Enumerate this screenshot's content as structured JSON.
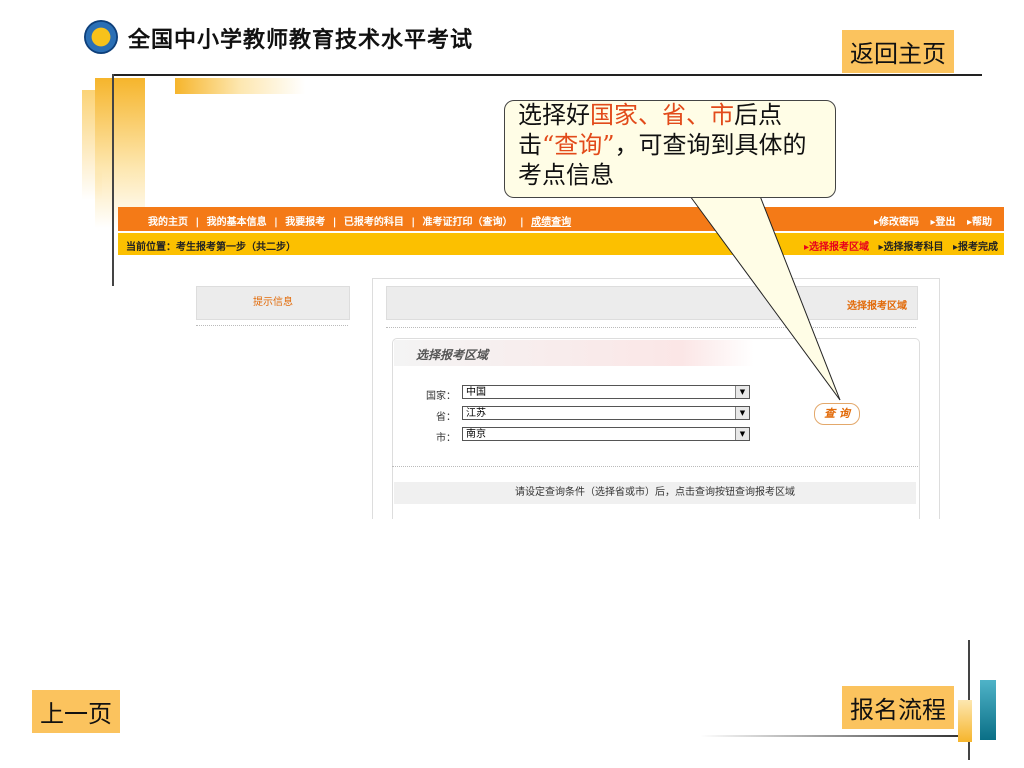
{
  "slide": {
    "title": "全国中小学教师教育技术水平考试",
    "home_button": "返回主页",
    "prev_button": "上一页",
    "flow_button": "报名流程"
  },
  "callout": {
    "part1": "选择好",
    "part2": "国家、省、市",
    "part3": "后点击",
    "part4": "“查询”",
    "part5": "，可查询到具体的考点信息"
  },
  "nav": {
    "links": [
      "我的主页",
      "|",
      "我的基本信息",
      "|",
      "我要报考",
      "|",
      "已报考的科目",
      "|",
      "准考证打印（查询）",
      "|",
      "成绩查询"
    ],
    "right": [
      "▸修改密码",
      "▸登出",
      "▸帮助"
    ]
  },
  "location": {
    "label": "当前位置：考生报考第一步（共二步）",
    "steps": [
      "▸选择报考区域",
      "▸选择报考科目",
      "▸报考完成"
    ]
  },
  "sidebar": {
    "tip_title": "提示信息"
  },
  "main": {
    "header": "选择报考区域",
    "panel_title": "选择报考区域",
    "country_label": "国家：",
    "country_value": "中国",
    "province_label": "省：",
    "province_value": "江苏",
    "city_label": "市：",
    "city_value": "南京",
    "query_button": "查 询",
    "hint": "请设定查询条件（选择省或市）后，点击查询按钮查询报考区域"
  },
  "colors": {
    "orange_nav": "#f47a17",
    "yellow_nav": "#fcc000",
    "slide_button": "#fbc35e"
  }
}
